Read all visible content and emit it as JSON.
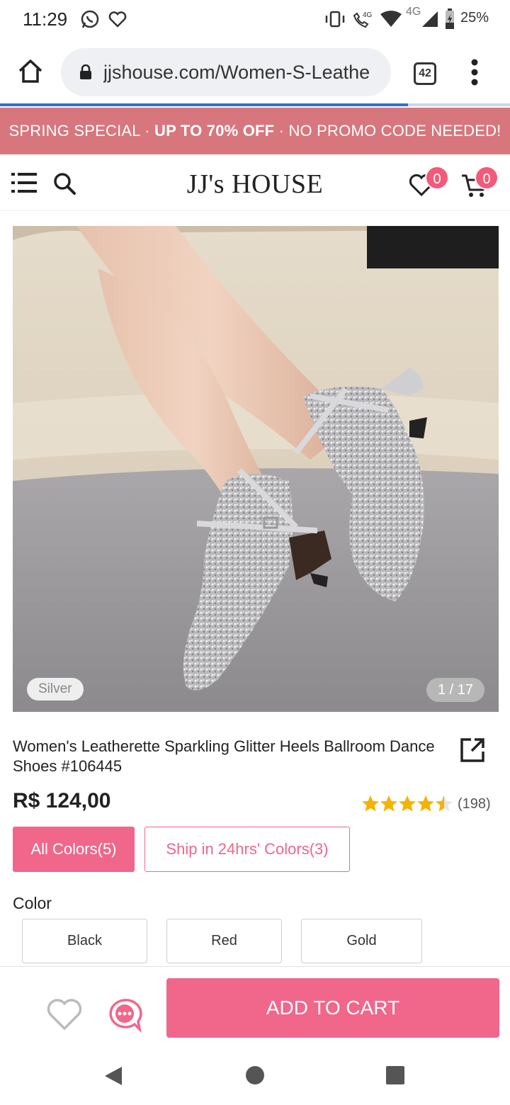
{
  "status_bar": {
    "time": "11:29",
    "network": "4G",
    "battery": "25%"
  },
  "browser": {
    "url": "jjshouse.com/Women-S-Leathe",
    "tab_count": "42"
  },
  "promo": {
    "part1": "SPRING SPECIAL · ",
    "part2": "UP TO 70% OFF",
    "part3": " · NO PROMO CODE NEEDED!"
  },
  "header": {
    "logo": "JJ's HOUSE",
    "wishlist_count": "0",
    "cart_count": "0"
  },
  "gallery": {
    "color_chip": "Silver",
    "counter": "1 / 17"
  },
  "product": {
    "title": "Women's Leatherette Sparkling Glitter Heels Ballroom Dance Shoes #106445",
    "price": "R$ 124,00",
    "rating": 4.5,
    "reviews": "(198)"
  },
  "filters": {
    "all_colors": "All Colors(5)",
    "ship_24": "Ship in 24hrs' Colors(3)"
  },
  "colors": {
    "label": "Color",
    "options": [
      "Black",
      "Red",
      "Gold"
    ]
  },
  "actions": {
    "add_to_cart": "ADD TO CART"
  },
  "theme": {
    "accent": "#f0678b",
    "promo_bg": "#d8767d",
    "star": "#f5b300"
  }
}
